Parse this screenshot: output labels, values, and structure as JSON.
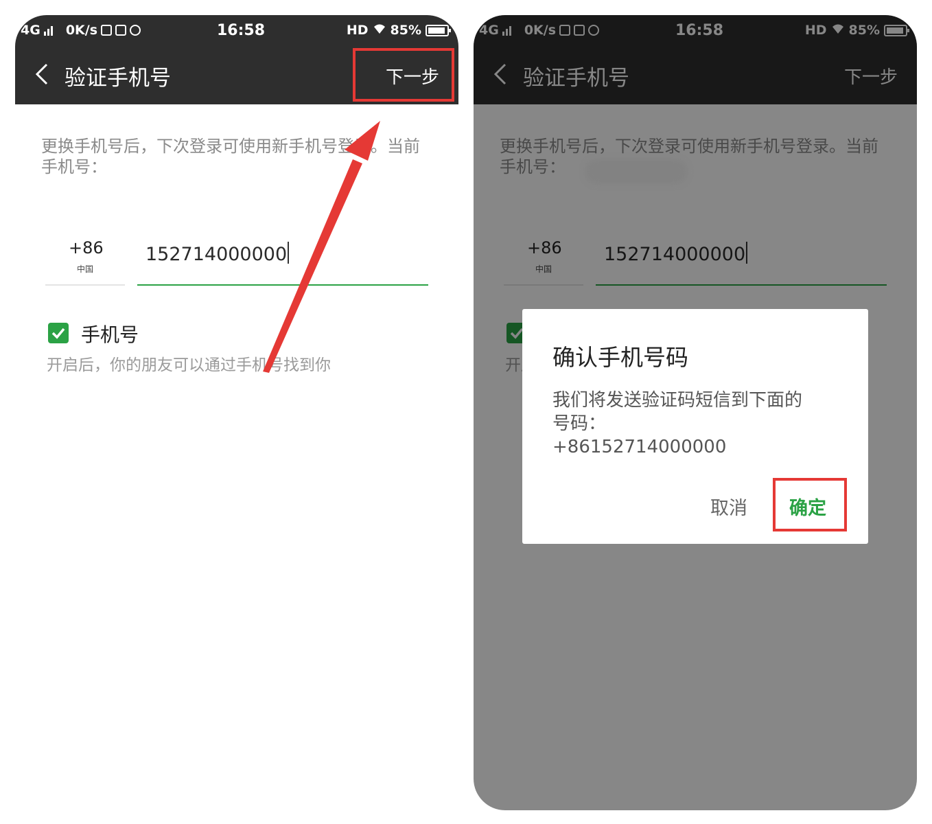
{
  "status_bar": {
    "network": "4G",
    "speed": "0K/s",
    "time": "16:58",
    "hd": "HD",
    "battery": "85%"
  },
  "nav": {
    "back_icon": "chevron-left-icon",
    "title": "验证手机号",
    "next": "下一步"
  },
  "form": {
    "description": "更换手机号后，下次登录可使用新手机号登录。当前手机号：",
    "country_code": "+86",
    "country_name": "中国",
    "phone_value": "152714000000",
    "checkbox_label": "手机号",
    "checkbox_checked": true,
    "checkbox_description": "开启后，你的朋友可以通过手机号找到你"
  },
  "dialog": {
    "title": "确认手机号码",
    "message_line1": "我们将发送验证码短信到下面的",
    "message_line2": "号码：",
    "message_number": "+86152714000000",
    "cancel": "取消",
    "confirm": "确定"
  },
  "colors": {
    "accent_green": "#2ba245",
    "highlight_red": "#e53935",
    "bar_dark": "#2e2e2e"
  }
}
